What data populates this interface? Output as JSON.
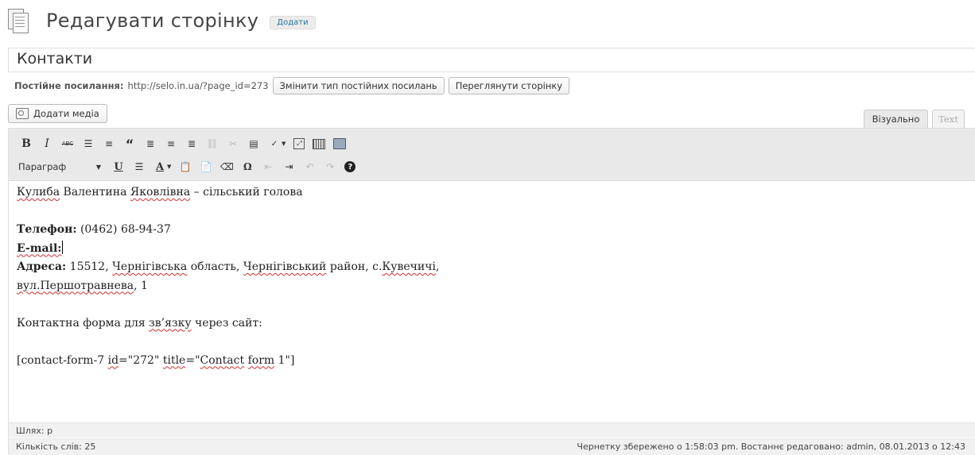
{
  "header": {
    "title": "Редагувати сторінку",
    "add_new": "Додати"
  },
  "post": {
    "title": "Контакти"
  },
  "permalink": {
    "label": "Постійне посилання:",
    "url": "http://selo.in.ua/?page_id=273",
    "change_button": "Змінити тип постійних посилань",
    "view_button": "Переглянути сторінку"
  },
  "media": {
    "add_label": "Додати медіа"
  },
  "tabs": {
    "visual": "Візуально",
    "text": "Text"
  },
  "toolbar": {
    "format_select": "Параграф",
    "icons": [
      "bold-icon",
      "italic-icon",
      "strikethrough-icon",
      "bullet-list-icon",
      "numbered-list-icon",
      "blockquote-icon",
      "align-left-icon",
      "align-center-icon",
      "align-right-icon",
      "link-icon",
      "unlink-icon",
      "more-tag-icon",
      "spellcheck-icon",
      "fullscreen-icon",
      "kitchen-sink-icon",
      "insert-image-icon",
      "underline-icon",
      "justify-icon",
      "text-color-icon",
      "paste-text-icon",
      "paste-word-icon",
      "clear-formatting-icon",
      "special-character-icon",
      "outdent-icon",
      "indent-icon",
      "undo-icon",
      "redo-icon",
      "help-icon"
    ]
  },
  "content": {
    "head_name": "Кулиба",
    "head_first": "Валентина",
    "head_patronymic": "Яковлівна",
    "head_role": "– сільський голова",
    "phone_label": "Телефон:",
    "phone_value": "(0462) 68-94-37",
    "email_label": "E-mail:",
    "address_label": "Адреса:",
    "address_zip": "15512,",
    "address_region": "Чернігівська",
    "address_word_oblast": "область,",
    "address_district": "Чернігівський",
    "address_word_raion": "район, с.",
    "address_village": "Кувечичі",
    "address_comma": ",",
    "address_street_prefix": "вул.",
    "address_street": "Першотравнева",
    "address_house": ", 1",
    "form_heading_1": "Контактна форма для",
    "form_heading_word": "зв’язку",
    "form_heading_2": "через сайт:",
    "shortcode_1": "[contact-form-7",
    "shortcode_id": "id",
    "shortcode_2": "=\"272\"",
    "shortcode_title": "title",
    "shortcode_3": "=\"",
    "shortcode_contact": "Contact",
    "shortcode_form": "form",
    "shortcode_4": "1\"]"
  },
  "status": {
    "path": "Шлях: p",
    "word_count": "Кількість слів: 25",
    "draft_saved": "Чернетку збережено о 1:58:03 pm. Востаннє редаговано: admin, 08.01.2013 о 12:43"
  }
}
